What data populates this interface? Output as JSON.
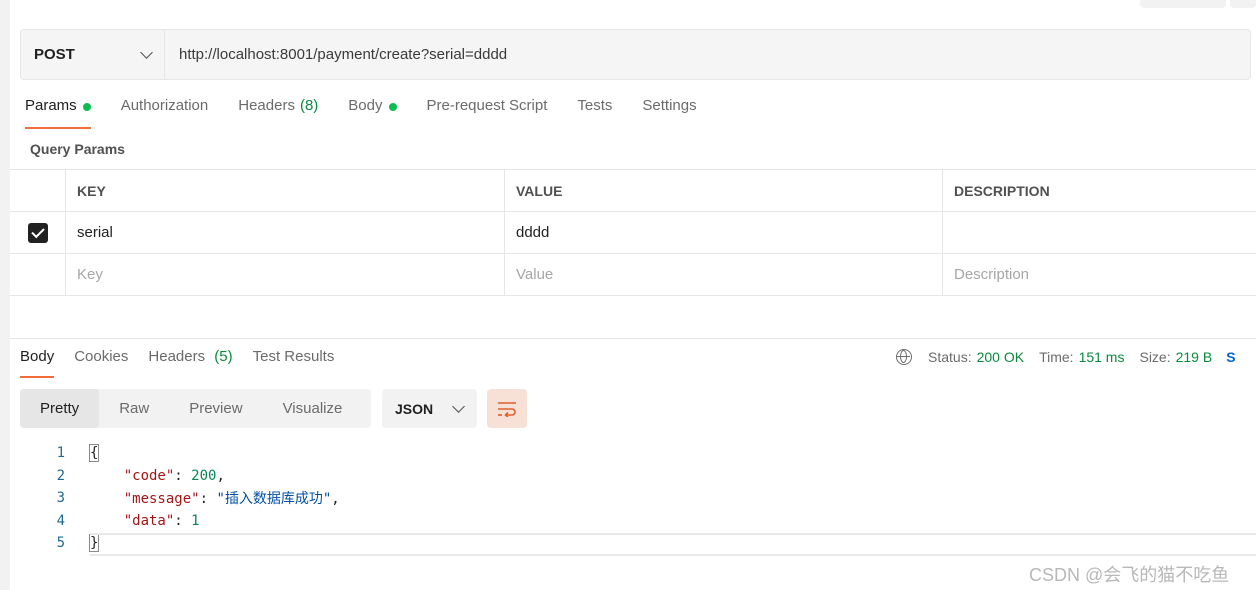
{
  "request": {
    "method": "POST",
    "url": "http://localhost:8001/payment/create?serial=dddd"
  },
  "request_tabs": [
    {
      "label": "Params",
      "dot": true,
      "active": true
    },
    {
      "label": "Authorization"
    },
    {
      "label": "Headers",
      "count": "(8)"
    },
    {
      "label": "Body",
      "dot": true
    },
    {
      "label": "Pre-request Script"
    },
    {
      "label": "Tests"
    },
    {
      "label": "Settings"
    }
  ],
  "query_params": {
    "title": "Query Params",
    "columns": [
      "KEY",
      "VALUE",
      "DESCRIPTION"
    ],
    "rows": [
      {
        "checked": true,
        "key": "serial",
        "value": "dddd",
        "description": ""
      }
    ],
    "placeholders": {
      "key": "Key",
      "value": "Value",
      "description": "Description"
    }
  },
  "response_tabs": [
    {
      "label": "Body",
      "active": true
    },
    {
      "label": "Cookies"
    },
    {
      "label": "Headers",
      "count": "(5)"
    },
    {
      "label": "Test Results"
    }
  ],
  "status": {
    "status_label": "Status:",
    "status_value": "200 OK",
    "time_label": "Time:",
    "time_value": "151 ms",
    "size_label": "Size:",
    "size_value": "219 B",
    "save_truncated": "S"
  },
  "format_options": [
    "Pretty",
    "Raw",
    "Preview",
    "Visualize"
  ],
  "format_active": "Pretty",
  "language": "JSON",
  "response_lines": [
    {
      "no": "1",
      "text": "{"
    },
    {
      "no": "2",
      "key": "\"code\"",
      "num": "200",
      "trail": ","
    },
    {
      "no": "3",
      "key": "\"message\"",
      "str": "\"插入数据库成功\"",
      "trail": ","
    },
    {
      "no": "4",
      "key": "\"data\"",
      "num": "1",
      "trail": ""
    },
    {
      "no": "5",
      "text": "}"
    }
  ],
  "watermark": "CSDN @会飞的猫不吃鱼",
  "colors": {
    "accent": "#f26b3a",
    "success": "#0a8a3c",
    "dot": "#0cbb52"
  },
  "icons": [
    "chevron-down-icon",
    "checkbox-checked-icon",
    "globe-icon",
    "wrap-lines-icon"
  ]
}
